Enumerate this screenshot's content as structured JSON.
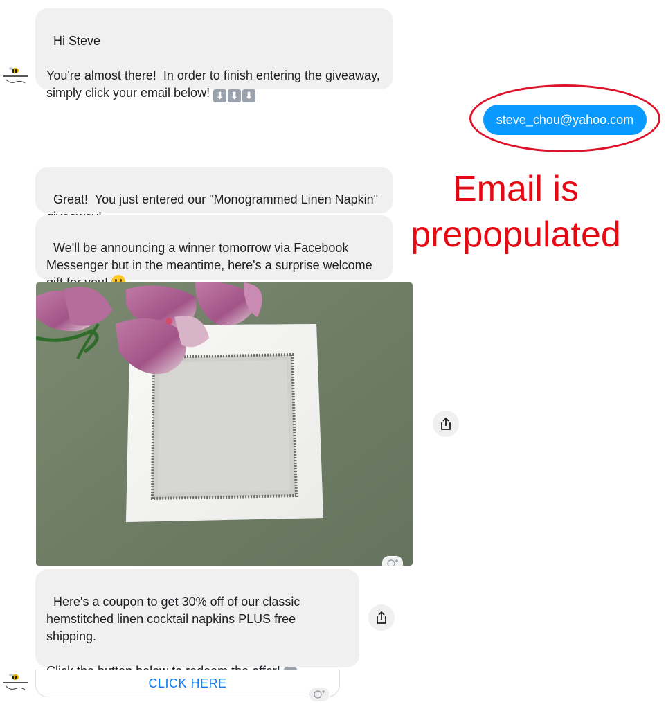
{
  "messages": {
    "greeting": "Hi Steve\n\nYou're almost there!  In order to finish entering the giveaway, simply click your email below! ",
    "confirmation": "Great!  You just entered our \"Monogrammed Linen Napkin\" giveaway!",
    "announcement": "We'll be announcing a winner tomorrow via Facebook Messenger but in the meantime, here's a surprise welcome gift for you! ",
    "coupon": "Here's a coupon to get 30% off of our classic hemstitched linen cocktail napkins PLUS free shipping.\n\nClick the button below to redeem the offer! "
  },
  "user_reply": {
    "email": "steve_chou@yahoo.com"
  },
  "annotation": {
    "text": "Email is prepopulated"
  },
  "cta": {
    "label": "CLICK HERE"
  },
  "icons": {
    "down_arrow": "⬇",
    "avatar": "bumblebee-logo-icon",
    "share": "share-icon",
    "reaction": "add-reaction-icon"
  },
  "colors": {
    "user_bubble": "#0a99ff",
    "bot_bubble": "#f1f0f0",
    "annotation": "#e50914",
    "cta_text": "#0a7cff"
  }
}
